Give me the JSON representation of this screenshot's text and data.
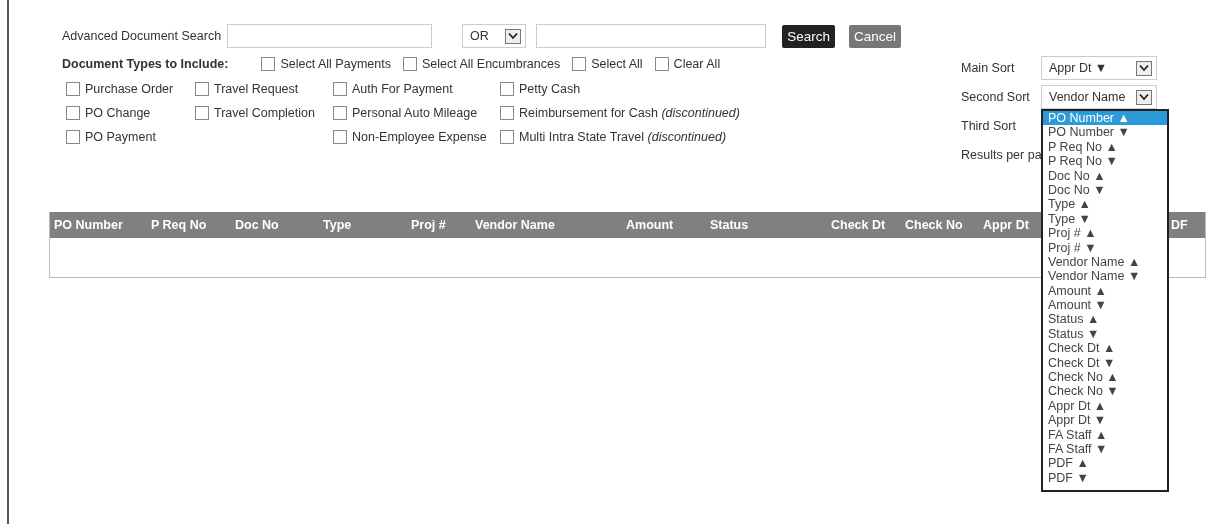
{
  "search": {
    "label": "Advanced Document Search",
    "operator": "OR",
    "search_button": "Search",
    "cancel_button": "Cancel"
  },
  "doc_types": {
    "label": "Document Types to Include:",
    "bulk": [
      {
        "label": "Select All Payments",
        "checked": false
      },
      {
        "label": "Select All Encumbrances",
        "checked": false
      },
      {
        "label": "Select All",
        "checked": false
      },
      {
        "label": "Clear All",
        "checked": false
      }
    ],
    "columns": [
      [
        {
          "label": "Purchase Order",
          "checked": false
        },
        {
          "label": "PO Change",
          "checked": false
        },
        {
          "label": "PO Payment",
          "checked": false
        }
      ],
      [
        {
          "label": "Travel Request",
          "checked": false
        },
        {
          "label": "Travel Completion",
          "checked": false
        }
      ],
      [
        {
          "label": "Auth For Payment",
          "checked": false
        },
        {
          "label": "Personal Auto Mileage",
          "checked": false
        },
        {
          "label": "Non-Employee Expense",
          "checked": false
        }
      ],
      [
        {
          "label": "Petty Cash",
          "checked": false
        },
        {
          "label": "Reimbursement for Cash *(discontinued)*",
          "checked": false
        },
        {
          "label": "Multi Intra State Travel *(discontinued)*",
          "checked": false
        }
      ]
    ]
  },
  "sort": {
    "main_label": "Main Sort",
    "main_value": "Appr Dt ▼",
    "second_label": "Second Sort",
    "second_value": "Vendor Name",
    "third_label": "Third Sort",
    "results_label": "Results per pa",
    "options": [
      {
        "label": "PO Number ▲",
        "selected": true
      },
      {
        "label": "PO Number ▼",
        "selected": false
      },
      {
        "label": "P Req No ▲",
        "selected": false
      },
      {
        "label": "P Req No ▼",
        "selected": false
      },
      {
        "label": "Doc No ▲",
        "selected": false
      },
      {
        "label": "Doc No ▼",
        "selected": false
      },
      {
        "label": "Type ▲",
        "selected": false
      },
      {
        "label": "Type ▼",
        "selected": false
      },
      {
        "label": "Proj # ▲",
        "selected": false
      },
      {
        "label": "Proj # ▼",
        "selected": false
      },
      {
        "label": "Vendor Name ▲",
        "selected": false
      },
      {
        "label": "Vendor Name ▼",
        "selected": false
      },
      {
        "label": "Amount ▲",
        "selected": false
      },
      {
        "label": "Amount ▼",
        "selected": false
      },
      {
        "label": "Status ▲",
        "selected": false
      },
      {
        "label": "Status ▼",
        "selected": false
      },
      {
        "label": "Check Dt ▲",
        "selected": false
      },
      {
        "label": "Check Dt ▼",
        "selected": false
      },
      {
        "label": "Check No ▲",
        "selected": false
      },
      {
        "label": "Check No ▼",
        "selected": false
      },
      {
        "label": "Appr Dt ▲",
        "selected": false
      },
      {
        "label": "Appr Dt ▼",
        "selected": false
      },
      {
        "label": "FA Staff ▲",
        "selected": false
      },
      {
        "label": "FA Staff ▼",
        "selected": false
      },
      {
        "label": "PDF ▲",
        "selected": false
      },
      {
        "label": "PDF ▼",
        "selected": false
      }
    ]
  },
  "table": {
    "columns": [
      "PO Number",
      "P Req No",
      "Doc No",
      "Type",
      "Proj #",
      "Vendor Name",
      "Amount",
      "Status",
      "Check Dt",
      "Check No",
      "Appr Dt",
      "DF"
    ]
  }
}
